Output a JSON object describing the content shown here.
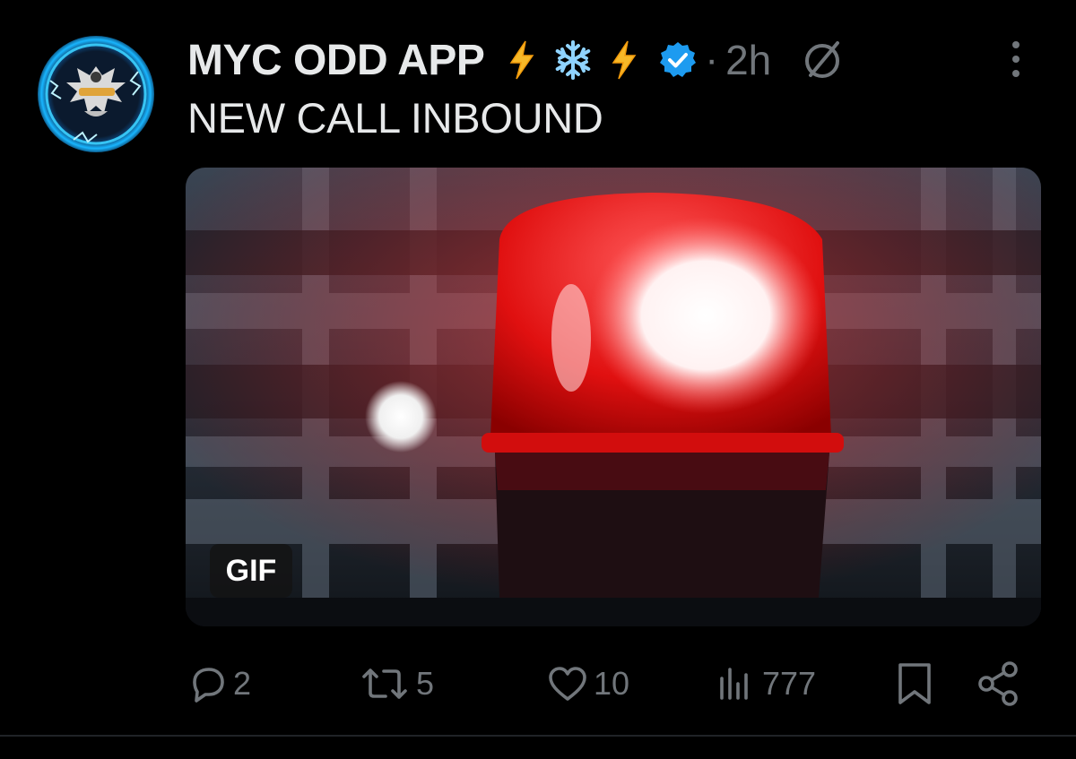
{
  "post": {
    "author_name": "MYC ODD APP",
    "name_emojis": [
      "lightning-emoji",
      "snowflake-emoji",
      "lightning-emoji"
    ],
    "separator": "·",
    "timestamp": "2h",
    "text": "NEW CALL INBOUND",
    "media": {
      "badge": "GIF"
    }
  },
  "actions": {
    "replies": "2",
    "reposts": "5",
    "likes": "10",
    "views": "777"
  },
  "colors": {
    "background": "#000000",
    "text_primary": "#e7e9ea",
    "text_secondary": "#71767b",
    "verified_blue": "#1d9bf0",
    "siren_red": "#ff1e1e"
  }
}
